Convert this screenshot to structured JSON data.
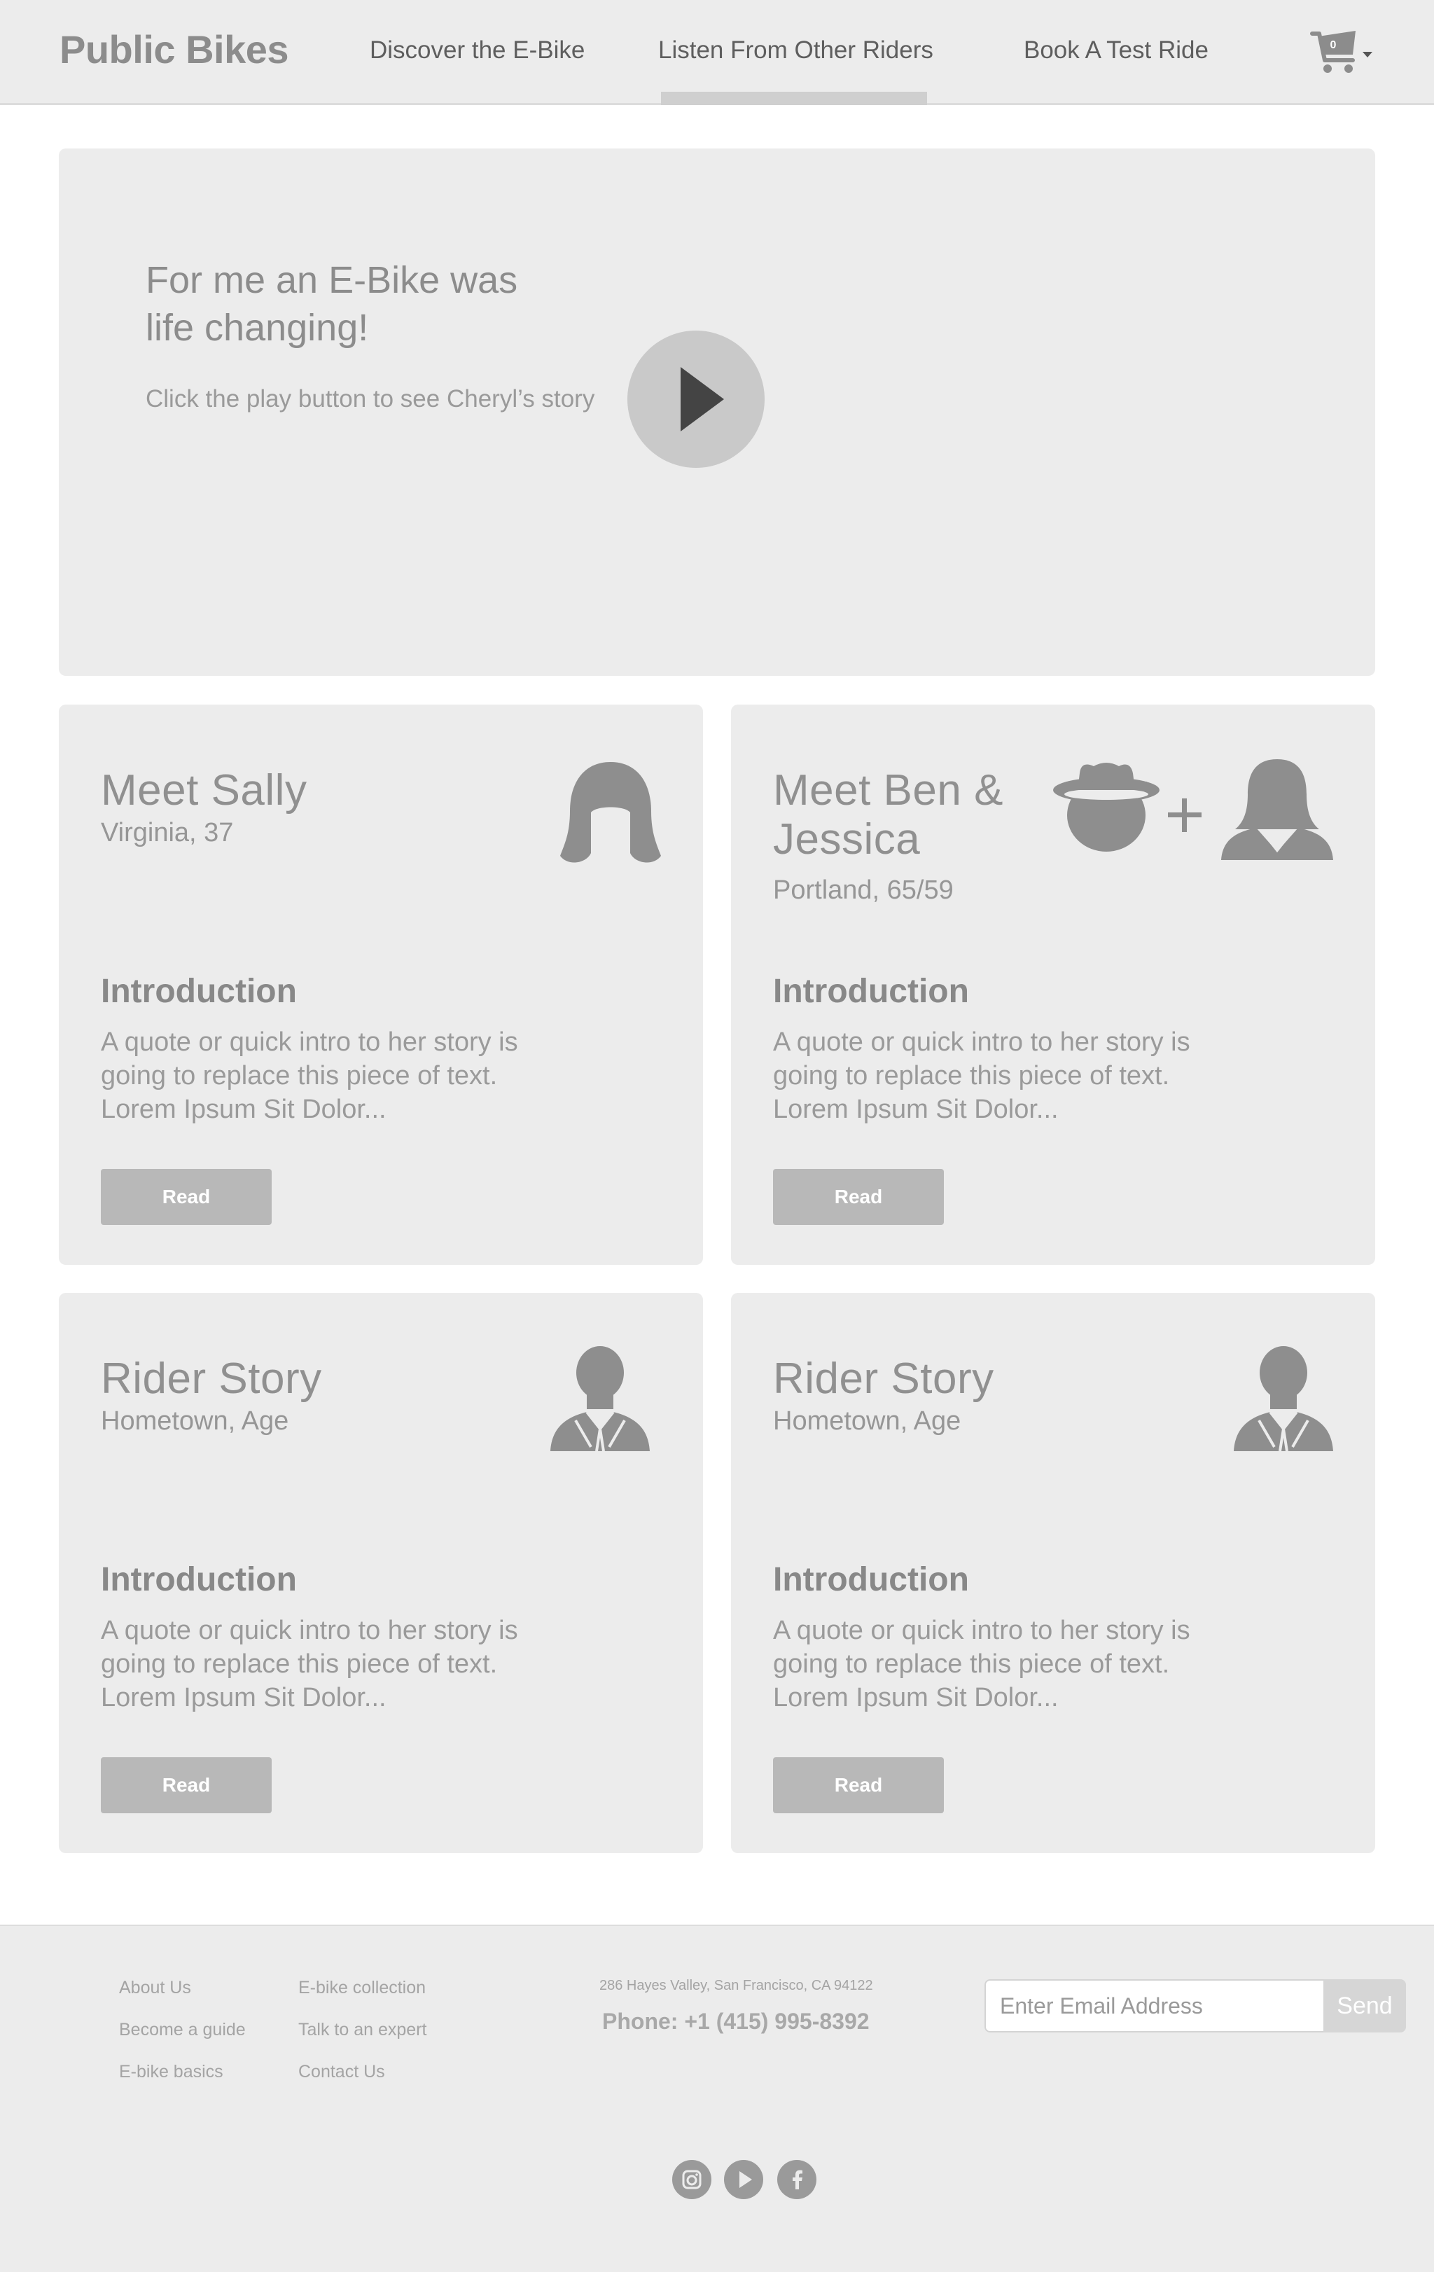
{
  "header": {
    "brand": "Public Bikes",
    "nav": [
      "Discover the E-Bike",
      "Listen From Other Riders",
      "Book A Test Ride"
    ],
    "active_nav": "Listen From Other Riders",
    "cart_count": "0",
    "cart_icon": "cart-icon"
  },
  "hero": {
    "title": "For me an E-Bike was life changing!",
    "subtitle": "Click the play button to see Cheryl’s story",
    "play_icon": "play-icon"
  },
  "cards": [
    {
      "name": "Meet Sally",
      "meta": "Virginia, 37",
      "intro_heading": "Introduction",
      "intro_text": "A quote or quick intro to her story is going to replace this piece of text. Lorem Ipsum Sit Dolor...",
      "button": "Read",
      "icon": "woman-hair-icon"
    },
    {
      "name": "Meet Ben & Jessica",
      "meta": "Portland, 65/59",
      "intro_heading": "Introduction",
      "intro_text": "A quote or quick intro to her story is going to replace this piece of text. Lorem Ipsum Sit Dolor...",
      "button": "Read",
      "icon": "couple-icon"
    },
    {
      "name": "Rider Story",
      "meta": "Hometown, Age",
      "intro_heading": "Introduction",
      "intro_text": "A quote or quick intro to her story is going to replace this piece of text. Lorem Ipsum Sit Dolor...",
      "button": "Read",
      "icon": "person-suit-icon"
    },
    {
      "name": "Rider Story",
      "meta": "Hometown, Age",
      "intro_heading": "Introduction",
      "intro_text": "A quote or quick intro to her story is going to replace this piece of text. Lorem Ipsum Sit Dolor...",
      "button": "Read",
      "icon": "person-suit-icon"
    }
  ],
  "footer": {
    "links_col1": [
      "About Us",
      "Become a guide",
      "E-bike basics"
    ],
    "links_col2": [
      "E-bike collection",
      "Talk to an expert",
      "Contact Us"
    ],
    "address": "286 Hayes Valley, San Francisco, CA 94122",
    "phone": "Phone: +1 (415) 995-8392",
    "email_placeholder": "Enter Email Address",
    "send_label": "Send",
    "social": [
      "instagram-icon",
      "youtube-icon",
      "facebook-icon"
    ]
  },
  "colors": {
    "header_bg": "#ececec",
    "card_bg": "#ececec",
    "button_bg": "#b8b8b8",
    "text_gray": "#8c8c8c"
  }
}
